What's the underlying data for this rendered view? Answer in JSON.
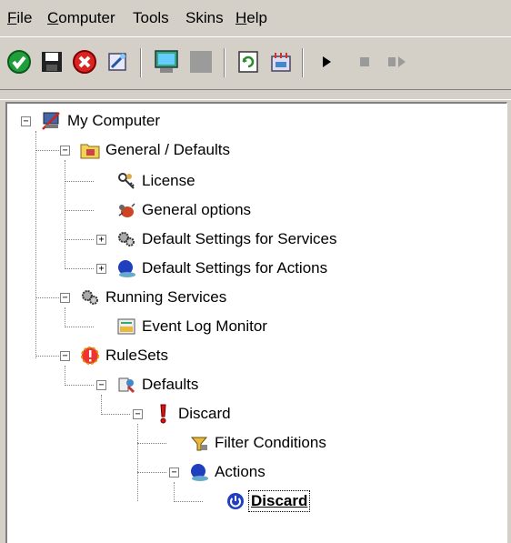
{
  "menu": [
    {
      "label": "File",
      "accel": "F"
    },
    {
      "label": "Computer",
      "accel": "C"
    },
    {
      "label": "Tools",
      "accel": ""
    },
    {
      "label": "Skins",
      "accel": ""
    },
    {
      "label": "Help",
      "accel": "H"
    }
  ],
  "toolbar": {
    "buttons": [
      "apply-check-icon",
      "save-disk-icon",
      "cancel-x-icon",
      "wizard-icon",
      "computer-network-icon",
      "disabled-icon",
      "refresh-icon",
      "config-icon",
      "play-icon",
      "stop-icon",
      "step-icon"
    ]
  },
  "tree": {
    "nodes": [
      {
        "label": "My Computer",
        "icon": "computer-icon"
      },
      {
        "label": "General / Defaults",
        "icon": "folder-defaults-icon"
      },
      {
        "label": "License",
        "icon": "license-keys-icon"
      },
      {
        "label": "General options",
        "icon": "bug-icon"
      },
      {
        "label": "Default Settings for Services",
        "icon": "gears-icon"
      },
      {
        "label": "Default Settings for Actions",
        "icon": "globe-actions-icon"
      },
      {
        "label": "Running Services",
        "icon": "gears-icon"
      },
      {
        "label": "Event Log Monitor",
        "icon": "event-log-icon"
      },
      {
        "label": "RuleSets",
        "icon": "ruleset-icon"
      },
      {
        "label": "Defaults",
        "icon": "defaults-icon"
      },
      {
        "label": "Discard",
        "icon": "exclamation-icon"
      },
      {
        "label": "Filter Conditions",
        "icon": "filter-icon"
      },
      {
        "label": "Actions",
        "icon": "globe-actions-icon"
      },
      {
        "label": "Discard",
        "icon": "power-icon"
      }
    ]
  }
}
